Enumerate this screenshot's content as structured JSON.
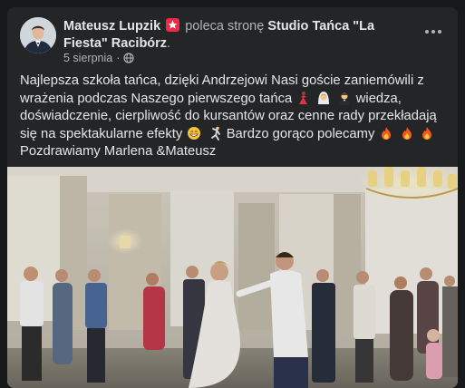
{
  "post": {
    "author": "Mateusz Lupzik",
    "action_text": "poleca stronę",
    "page_name": "Studio Tańca \"La Fiesta\" Racibórz",
    "date": "5 sierpnia",
    "meta_separator": "·",
    "text_part1": "Najlepsza szkoła tańca, dzięki Andrzejowi Nasi goście zaniemówili z wrażenia podczas Naszego pierwszego tańca",
    "text_part2": " wiedza, doświadczenie, cierpliwość do kursantów oraz cenne rady przekładają się na spektakularne efekty ",
    "text_part3": " Bardzo gorąco polecamy ",
    "text_part4": "Pozdrawiamy Marlena &Mateusz"
  },
  "icons": {
    "recommend_badge": "recommend-badge-icon",
    "audience": "globe-icon",
    "more": "more-options-icon",
    "emojis": [
      "dancer-emoji",
      "bride-emoji",
      "groom-emoji",
      "grinning-face-emoji",
      "dancing-man-emoji",
      "fire-emoji"
    ]
  },
  "colors": {
    "card": "#242526",
    "background": "#18191a",
    "primary_text": "#e4e6eb",
    "secondary_text": "#b0b3b8",
    "badge": "#f02849"
  }
}
